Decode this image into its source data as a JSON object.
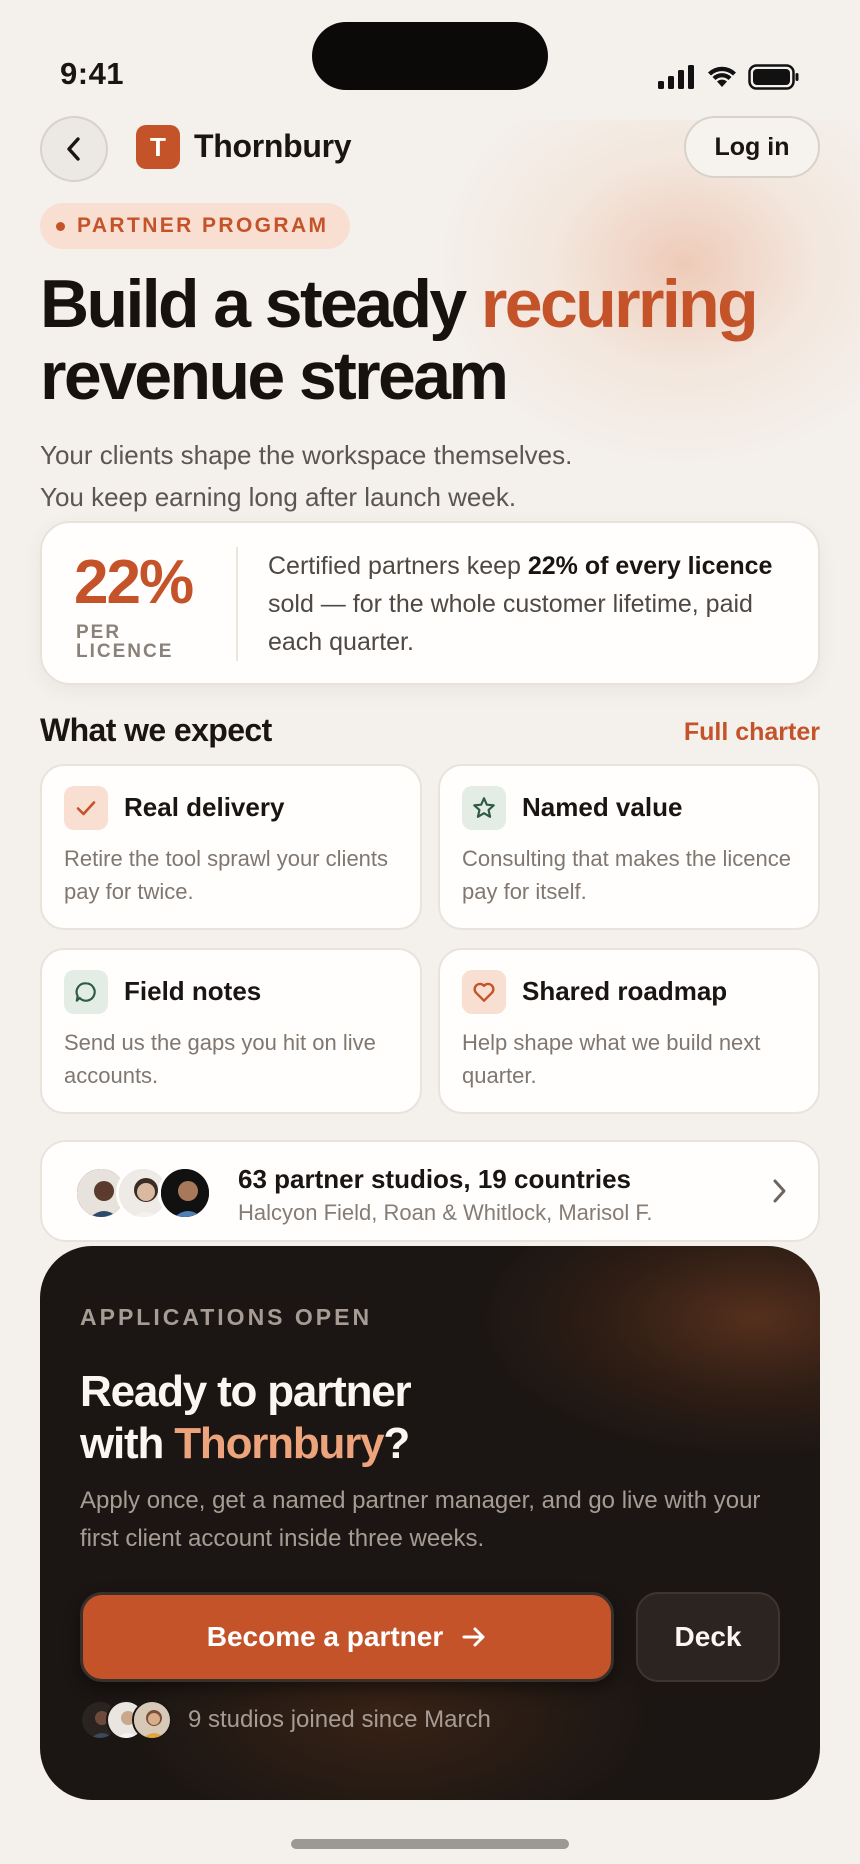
{
  "status_bar": {
    "time": "9:41"
  },
  "nav": {
    "brand_initial": "T",
    "brand_name": "Thornbury",
    "login_label": "Log in"
  },
  "hero": {
    "eyebrow": "PARTNER PROGRAM",
    "title_part1": "Build a steady ",
    "title_accent": "recurring",
    "title_part2": "revenue stream",
    "subtitle_line1": "Your clients shape the workspace themselves.",
    "subtitle_line2": "You keep earning long after launch week."
  },
  "stat": {
    "value": "22%",
    "unit": "PER LICENCE",
    "text_prefix": "Certified partners keep ",
    "text_bold": "22% of every licence",
    "text_suffix": " sold — for the whole customer lifetime, paid each quarter."
  },
  "expect": {
    "title": "What we expect",
    "link": "Full charter",
    "items": [
      {
        "icon": "check-icon",
        "title": "Real delivery",
        "desc": "Retire the tool sprawl your clients pay for twice."
      },
      {
        "icon": "star-icon",
        "title": "Named value",
        "desc": "Consulting that makes the licence pay for itself."
      },
      {
        "icon": "chat-bubble-icon",
        "title": "Field notes",
        "desc": "Send us the gaps you hit on live accounts."
      },
      {
        "icon": "heart-icon",
        "title": "Shared roadmap",
        "desc": "Help shape what we build next quarter."
      }
    ]
  },
  "social": {
    "title": "63 partner studios, 19 countries",
    "subtitle": "Halcyon Field, Roan & Whitlock, Marisol F."
  },
  "cta": {
    "eyebrow": "APPLICATIONS OPEN",
    "title_line1": "Ready to partner",
    "title_with": "with ",
    "title_accent": "Thornbury",
    "title_end": "?",
    "description": "Apply once, get a named partner manager, and go live with your first client account inside three weeks.",
    "primary_label": "Become a partner",
    "secondary_label": "Deck",
    "joined": "9 studios joined since March"
  },
  "colors": {
    "accent": "#c4532a",
    "dark": "#1b1613",
    "accent_light": "#eda37b"
  }
}
